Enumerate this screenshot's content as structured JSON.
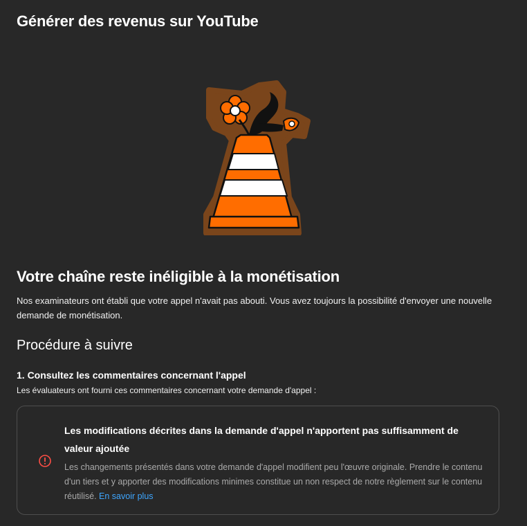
{
  "header": {
    "title": "Générer des revenus sur YouTube"
  },
  "illustration": {
    "icon": "traffic-cone-with-flowers"
  },
  "status": {
    "title": "Votre chaîne reste inéligible à la monétisation",
    "description": "Nos examinateurs ont établi que votre appel n'avait pas abouti. Vous avez toujours la possibilité d'envoyer une nouvelle demande de monétisation."
  },
  "next_steps": {
    "title": "Procédure à suivre",
    "step1": {
      "title": "1. Consultez les commentaires concernant l'appel",
      "description": "Les évaluateurs ont fourni ces commentaires concernant votre demande d'appel :"
    }
  },
  "feedback": {
    "icon": "alert-circle-icon",
    "title": "Les modifications décrites dans la demande d'appel n'apportent pas suffisamment de valeur ajoutée",
    "body": "Les changements présentés dans votre demande d'appel modifient peu l'œuvre originale. Prendre le contenu d'un tiers et y apporter des modifications minimes constitue un non respect de notre règlement sur le contenu réutilisé.",
    "link_label": "En savoir plus"
  },
  "colors": {
    "background": "#282828",
    "cone_orange": "#ff6d00",
    "outline_brown": "#8a4f1c",
    "alert_red": "#ff4e45",
    "link_blue": "#3ea6ff"
  }
}
